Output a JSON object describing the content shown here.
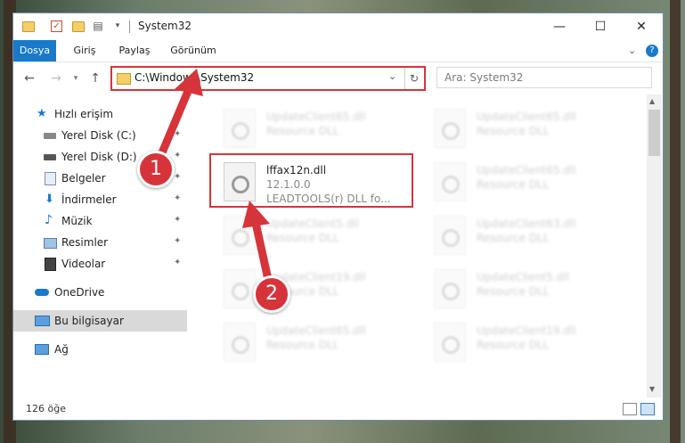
{
  "window": {
    "title": "System32",
    "controls": {
      "minimize": "—",
      "maximize": "☐",
      "close": "✕"
    }
  },
  "ribbon": {
    "tabs": [
      "Dosya",
      "Giriş",
      "Paylaş",
      "Görünüm"
    ],
    "expand": "⌄",
    "help": "?"
  },
  "navigation": {
    "back": "←",
    "forward": "→",
    "up": "↑",
    "path": "C:\\Windows\\System32",
    "dropdown": "⌄",
    "refresh": "↻",
    "search_placeholder": "Ara: System32"
  },
  "sidebar": {
    "items": [
      {
        "label": "Hızlı erişim",
        "icon": "star-icon",
        "pinned": false
      },
      {
        "label": "Yerel Disk (C:)",
        "icon": "drive-icon",
        "pinned": true
      },
      {
        "label": "Yerel Disk (D:)",
        "icon": "drive-icon",
        "pinned": true
      },
      {
        "label": "Belgeler",
        "icon": "documents-icon",
        "pinned": true
      },
      {
        "label": "İndirmeler",
        "icon": "download-icon",
        "pinned": true
      },
      {
        "label": "Müzik",
        "icon": "music-icon",
        "pinned": true
      },
      {
        "label": "Resimler",
        "icon": "pictures-icon",
        "pinned": true
      },
      {
        "label": "Videolar",
        "icon": "video-icon",
        "pinned": true
      },
      {
        "label": "OneDrive",
        "icon": "cloud-icon",
        "pinned": false
      },
      {
        "label": "Bu bilgisayar",
        "icon": "computer-icon",
        "pinned": false,
        "selected": true
      },
      {
        "label": "Ağ",
        "icon": "network-icon",
        "pinned": false
      }
    ],
    "pin_glyph": "📌"
  },
  "files": [
    {
      "name": "UpdateClient65.dll",
      "line2": "Resource DLL",
      "line3": "",
      "blurred": true
    },
    {
      "name": "UpdateClient65.dll",
      "line2": "Resource DLL",
      "line3": "",
      "blurred": true
    },
    {
      "name": "lffax12n.dll",
      "line2": "12.1.0.0",
      "line3": "LEADTOOLS(r) DLL fo...",
      "blurred": false
    },
    {
      "name": "UpdateClient65.dll",
      "line2": "Resource DLL",
      "line3": "",
      "blurred": true
    },
    {
      "name": "UpdateClient5.dll",
      "line2": "Resource DLL",
      "line3": "",
      "blurred": true
    },
    {
      "name": "UpdateClient63.dll",
      "line2": "Resource DLL",
      "line3": "",
      "blurred": true
    },
    {
      "name": "UpdateClient19.dll",
      "line2": "Resource DLL",
      "line3": "",
      "blurred": true
    },
    {
      "name": "UpdateClient5.dll",
      "line2": "Resource DLL",
      "line3": "",
      "blurred": true
    },
    {
      "name": "UpdateClient65.dll",
      "line2": "Resource DLL",
      "line3": "",
      "blurred": true
    },
    {
      "name": "UpdateClient19.dll",
      "line2": "Resource DLL",
      "line3": "",
      "blurred": true
    }
  ],
  "status": {
    "item_count": "126 öğe"
  },
  "annotations": {
    "badge1": "1",
    "badge2": "2",
    "accent": "#d6343a"
  }
}
